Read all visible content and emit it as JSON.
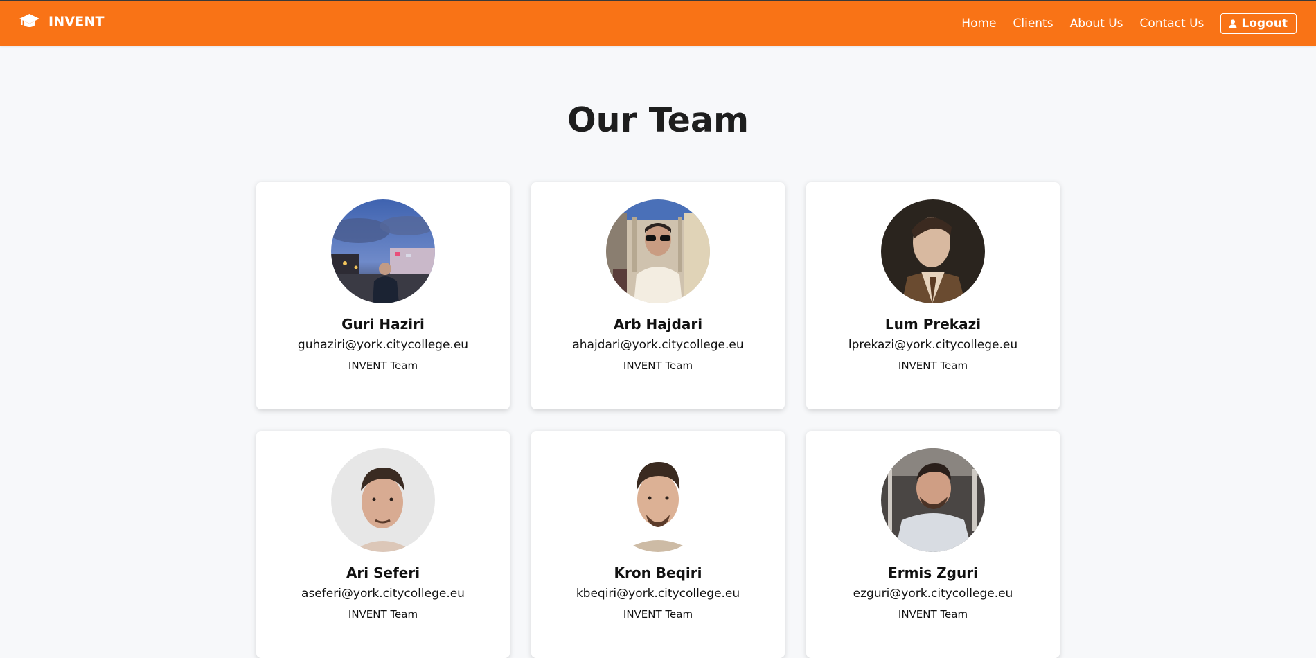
{
  "brand": {
    "name": "INVENT",
    "icon": "graduation-cap-icon"
  },
  "nav": {
    "links": [
      "Home",
      "Clients",
      "About Us",
      "Contact Us"
    ],
    "logout_label": "Logout",
    "logout_icon": "user-icon"
  },
  "colors": {
    "accent": "#f97316",
    "background": "#f7f8fa",
    "card": "#ffffff"
  },
  "page": {
    "title": "Our Team"
  },
  "team": [
    {
      "name": "Guri Haziri",
      "email": "guhaziri@york.citycollege.eu",
      "team": "INVENT Team"
    },
    {
      "name": "Arb Hajdari",
      "email": "ahajdari@york.citycollege.eu",
      "team": "INVENT Team"
    },
    {
      "name": "Lum Prekazi",
      "email": "lprekazi@york.citycollege.eu",
      "team": "INVENT Team"
    },
    {
      "name": "Ari Seferi",
      "email": "aseferi@york.citycollege.eu",
      "team": "INVENT Team"
    },
    {
      "name": "Kron Beqiri",
      "email": "kbeqiri@york.citycollege.eu",
      "team": "INVENT Team"
    },
    {
      "name": "Ermis Zguri",
      "email": "ezguri@york.citycollege.eu",
      "team": "INVENT Team"
    }
  ]
}
